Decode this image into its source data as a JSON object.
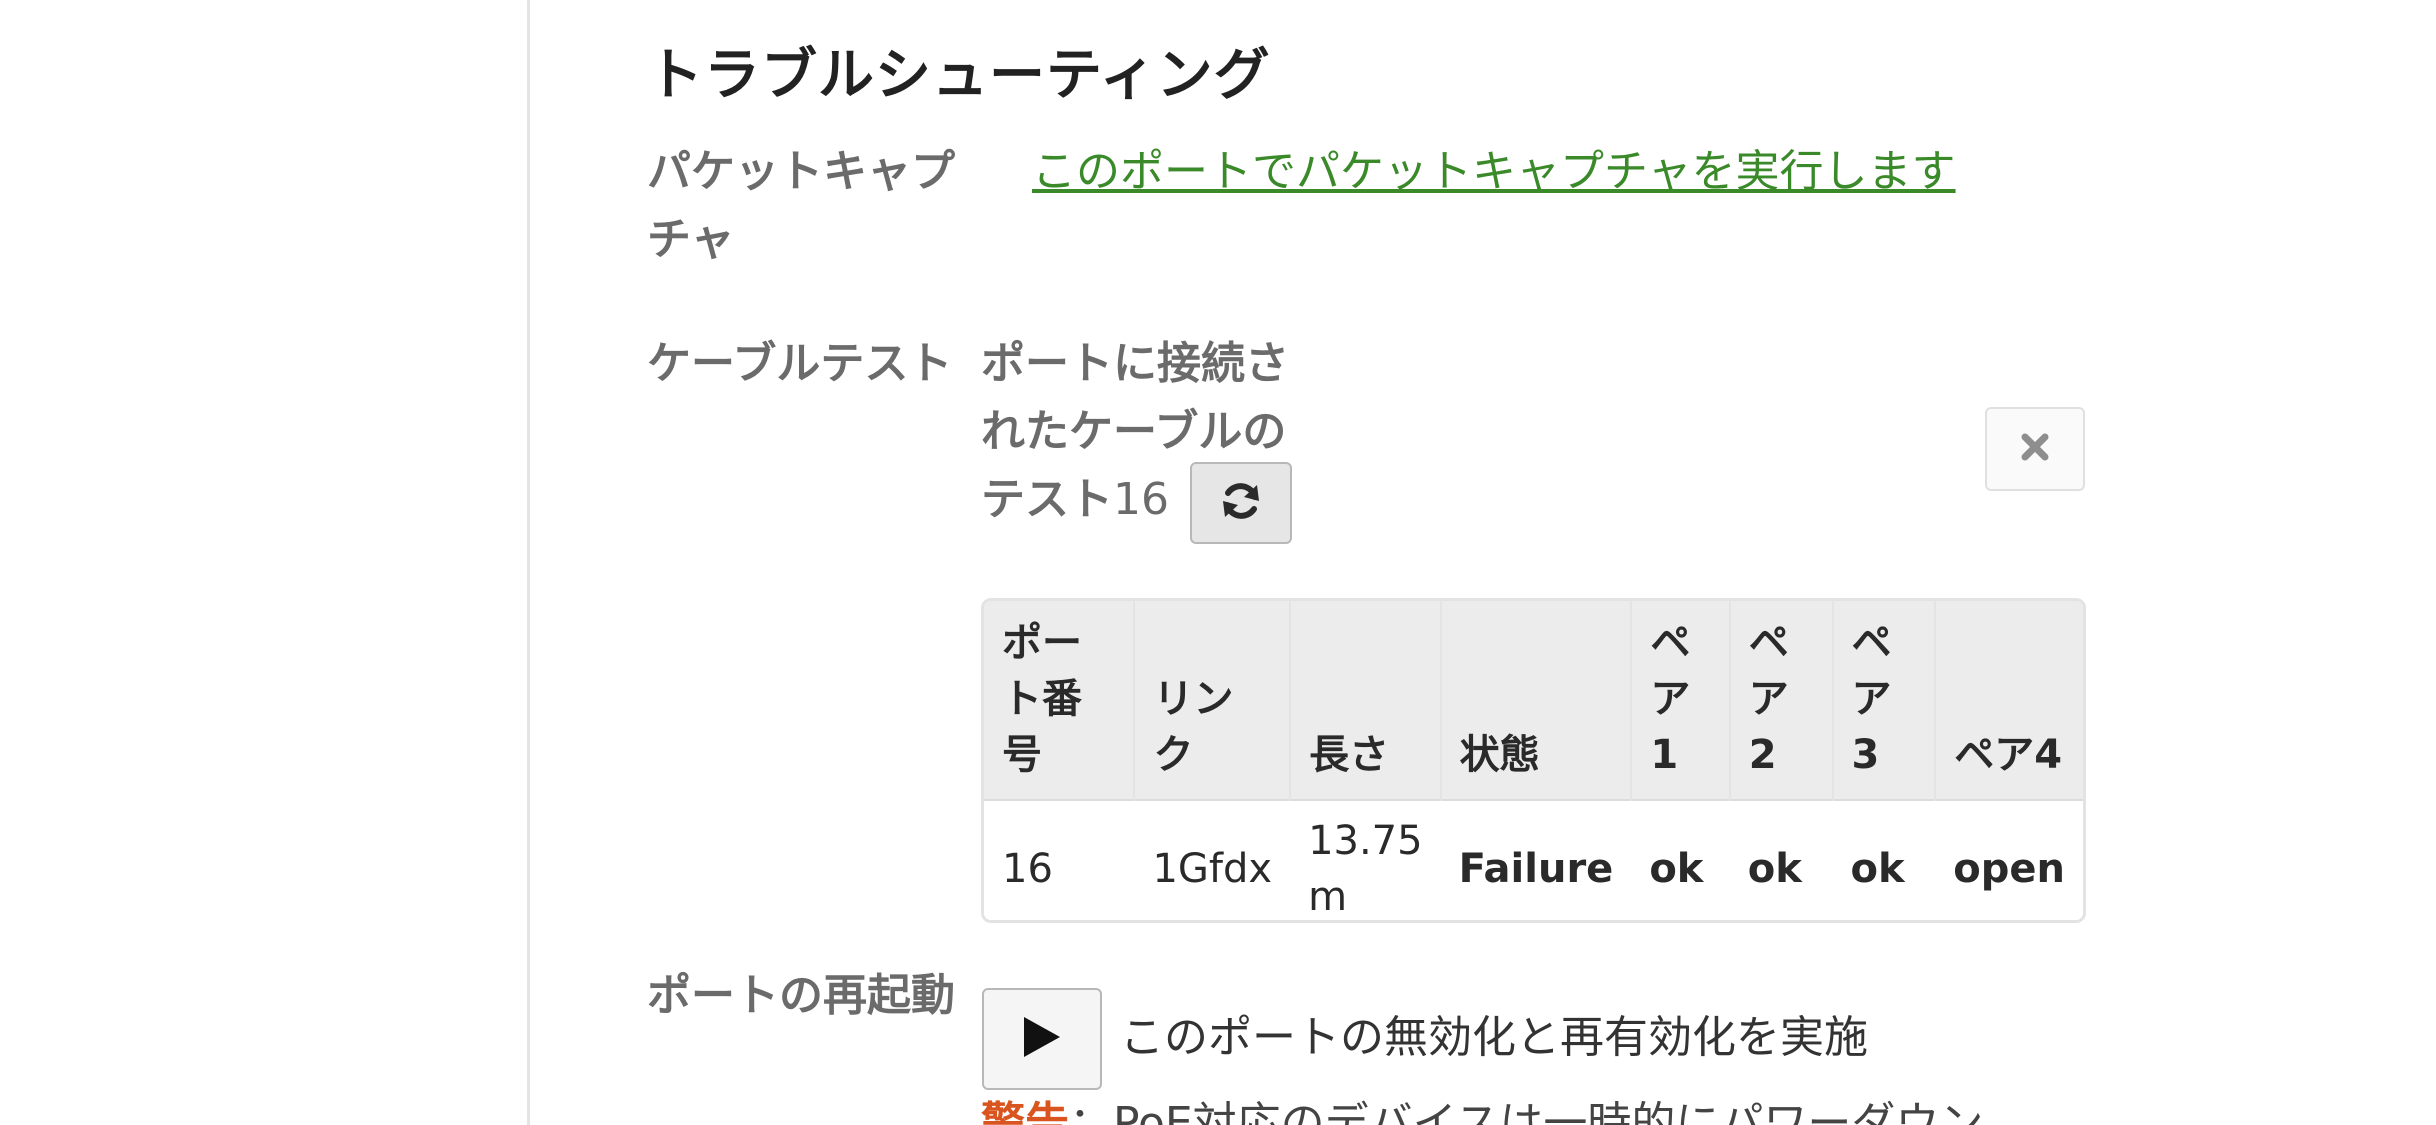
{
  "section": {
    "title": "トラブルシューティング"
  },
  "packet_capture": {
    "label": "パケットキャプチャ",
    "link_text": "このポートでパケットキャプチャを実行します"
  },
  "cable_test": {
    "label": "ケーブルテスト",
    "description": "ポートに接続されたケーブルのテスト",
    "port_number": "16",
    "refresh_icon": "refresh-icon",
    "close_icon": "close-icon",
    "table": {
      "headers": [
        "ポート番号",
        "リンク",
        "長さ",
        "状態",
        "ペア1",
        "ペア2",
        "ペア3",
        "ペア4"
      ],
      "rows": [
        {
          "port": "16",
          "link": "1Gfdx",
          "length": "13.75 m",
          "status": "Failure",
          "pair1": "ok",
          "pair2": "ok",
          "pair3": "ok",
          "pair4": "open"
        }
      ]
    }
  },
  "port_restart": {
    "label": "ポートの再起動",
    "play_icon": "play-icon",
    "description": "このポートの無効化と再有効化を実施",
    "warning_word": "警告",
    "warning_text": "：PoE対応のデバイスは一時的にパワーダウン"
  },
  "colors": {
    "link_green": "#3a8a2a",
    "status_red": "#d9301e",
    "label_gray": "#6b6b6b"
  }
}
